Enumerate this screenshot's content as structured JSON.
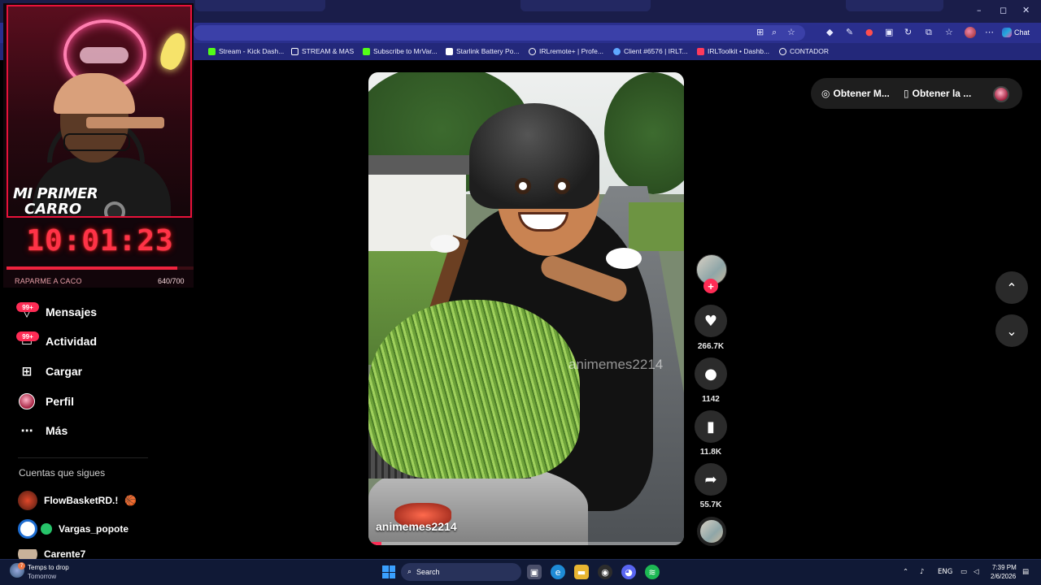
{
  "browser": {
    "window_controls": {
      "minimize": "–",
      "maximize": "◻",
      "close": "✕"
    },
    "chat_label": "Chat",
    "bookmarks": [
      {
        "label": "Stream - Kick Dash...",
        "icon": "kick-icon",
        "color": "#53fc18"
      },
      {
        "label": "STREAM & MAS",
        "icon": "folder-icon",
        "color": "#ffffff"
      },
      {
        "label": "Subscribe to MrVar...",
        "icon": "kick-icon",
        "color": "#53fc18"
      },
      {
        "label": "Starlink Battery Po...",
        "icon": "page-icon",
        "color": "#ffffff"
      },
      {
        "label": "IRLremote+ | Profe...",
        "icon": "globe-icon",
        "color": "#ffffff"
      },
      {
        "label": "Client #6576 | IRLT...",
        "icon": "cloud-icon",
        "color": "#5fa8ff"
      },
      {
        "label": "IRLToolkit • Dashb...",
        "icon": "irltoolkit-icon",
        "color": "#ff3a5c"
      },
      {
        "label": "CONTADOR",
        "icon": "counter-icon",
        "color": "#ffffff"
      }
    ]
  },
  "stream_overlay": {
    "banner_line1": "MI PRIMER",
    "banner_line2": "CARRO",
    "timer": "10:01:23",
    "goal_label": "RAPARME A CACO",
    "goal_count": "640/700",
    "goal_progress": 0.914
  },
  "sidebar": {
    "items": [
      {
        "label": "Mensajes",
        "icon": "messages-icon",
        "badge": "99+"
      },
      {
        "label": "Actividad",
        "icon": "activity-icon",
        "badge": "99+"
      },
      {
        "label": "Cargar",
        "icon": "upload-icon",
        "badge": ""
      },
      {
        "label": "Perfil",
        "icon": "profile-avatar",
        "badge": ""
      },
      {
        "label": "Más",
        "icon": "more-icon",
        "badge": ""
      }
    ],
    "following_heading": "Cuentas que sigues",
    "following": [
      {
        "name": "FlowBasketRD.!",
        "emoji": "🏀"
      },
      {
        "name": "Vargas_popote",
        "emoji": ""
      },
      {
        "name": "Carente7",
        "emoji": ""
      }
    ]
  },
  "video": {
    "watermark": "animemes2214",
    "author": "animemes2214",
    "progress": 0.04
  },
  "actions": {
    "likes": "266.7K",
    "comments": "1142",
    "saves": "11.8K",
    "shares": "55.7K"
  },
  "top_pill": {
    "item1": "Obtener M...",
    "item2": "Obtener la ..."
  },
  "taskbar": {
    "weather_line1": "Temps to drop",
    "weather_line2": "Tomorrow",
    "weather_badge": "7",
    "search_label": "Search",
    "lang": "ENG",
    "time": "7:39 PM",
    "date": "2/6/2026"
  },
  "colors": {
    "accent": "#fe2c55",
    "browser_chrome": "#2a2f8e",
    "timer_red": "#ff3347"
  }
}
